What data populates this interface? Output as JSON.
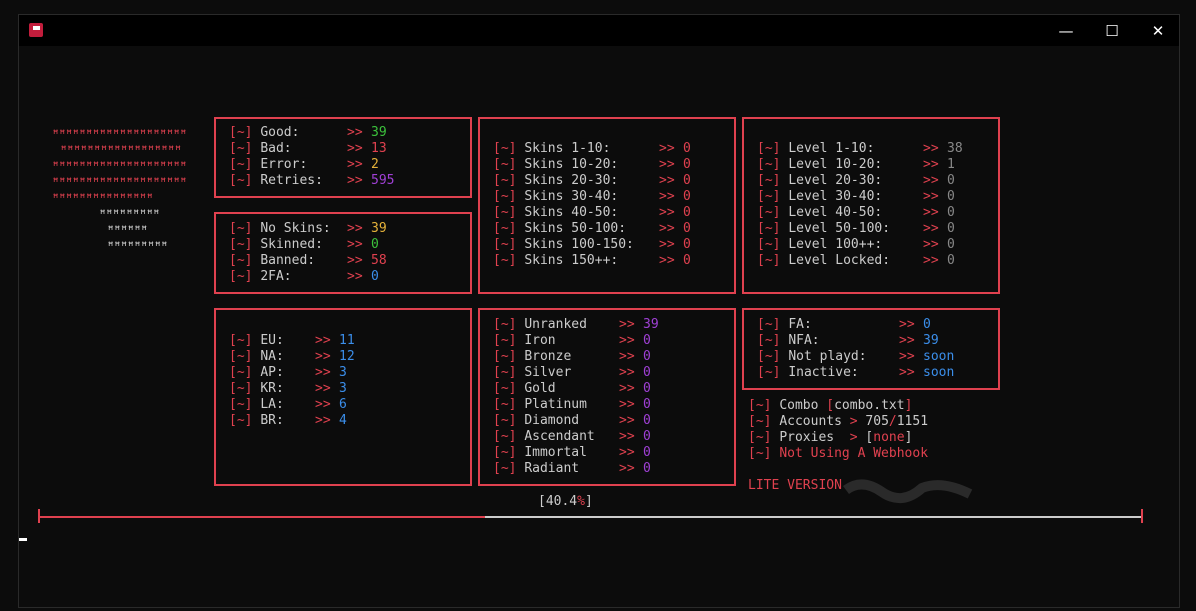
{
  "colors": {
    "accent": "#e0414f",
    "green": "#3cc23c",
    "yellow": "#e5b23a",
    "purple": "#a040d6",
    "blue": "#3b8eea",
    "gray": "#888888",
    "text": "#cccccc"
  },
  "icons": {
    "app": "app-icon",
    "minimize": "minimize-icon",
    "maximize": "maximize-icon",
    "close": "close-icon"
  },
  "titlebar": {
    "min": "—",
    "max": "☐",
    "close": "✕"
  },
  "logo": [
    "ꟸꟸꟸꟸꟸꟸꟸꟸꟸꟸꟸꟸꟸꟸꟸꟸꟸꟸꟸꟸ",
    "ꟸꟸꟸꟸꟸꟸꟸꟸꟸꟸꟸꟸꟸꟸꟸꟸꟸꟸ",
    "ꟸꟸꟸꟸꟸꟸꟸꟸꟸꟸꟸꟸꟸꟸꟸꟸꟸꟸꟸꟸ",
    "ꟸꟸꟸꟸꟸꟸꟸꟸꟸꟸꟸꟸꟸꟸꟸꟸꟸꟸꟸꟸ",
    "ꟸꟸꟸꟸꟸꟸꟸꟸꟸꟸꟸꟸꟸꟸꟸ",
    "ꟸꟸꟸꟸꟸꟸꟸꟸꟸ",
    "ꟸꟸꟸꟸꟸꟸ",
    "ꟸꟸꟸꟸꟸꟸꟸꟸꟸ"
  ],
  "prefix": "[~]",
  "arrow": ">>",
  "results": [
    {
      "label": "Good:",
      "value": "39"
    },
    {
      "label": "Bad:",
      "value": "13"
    },
    {
      "label": "Error:",
      "value": "2"
    },
    {
      "label": "Retries:",
      "value": "595"
    }
  ],
  "account_status": [
    {
      "label": "No Skins:",
      "value": "39"
    },
    {
      "label": "Skinned:",
      "value": "0"
    },
    {
      "label": "Banned:",
      "value": "58"
    },
    {
      "label": "2FA:",
      "value": "0"
    }
  ],
  "regions": [
    {
      "label": "EU:",
      "value": "11"
    },
    {
      "label": "NA:",
      "value": "12"
    },
    {
      "label": "AP:",
      "value": "3"
    },
    {
      "label": "KR:",
      "value": "3"
    },
    {
      "label": "LA:",
      "value": "6"
    },
    {
      "label": "BR:",
      "value": "4"
    }
  ],
  "skins": [
    {
      "label": "Skins 1-10:",
      "value": "0"
    },
    {
      "label": "Skins 10-20:",
      "value": "0"
    },
    {
      "label": "Skins 20-30:",
      "value": "0"
    },
    {
      "label": "Skins 30-40:",
      "value": "0"
    },
    {
      "label": "Skins 40-50:",
      "value": "0"
    },
    {
      "label": "Skins 50-100:",
      "value": "0"
    },
    {
      "label": "Skins 100-150:",
      "value": "0"
    },
    {
      "label": "Skins 150++:",
      "value": "0"
    }
  ],
  "ranks": [
    {
      "label": "Unranked",
      "value": "39"
    },
    {
      "label": "Iron",
      "value": "0"
    },
    {
      "label": "Bronze",
      "value": "0"
    },
    {
      "label": "Silver",
      "value": "0"
    },
    {
      "label": "Gold",
      "value": "0"
    },
    {
      "label": "Platinum",
      "value": "0"
    },
    {
      "label": "Diamond",
      "value": "0"
    },
    {
      "label": "Ascendant",
      "value": "0"
    },
    {
      "label": "Immortal",
      "value": "0"
    },
    {
      "label": "Radiant",
      "value": "0"
    }
  ],
  "levels": [
    {
      "label": "Level 1-10:",
      "value": "38"
    },
    {
      "label": "Level 10-20:",
      "value": "1"
    },
    {
      "label": "Level 20-30:",
      "value": "0"
    },
    {
      "label": "Level 30-40:",
      "value": "0"
    },
    {
      "label": "Level 40-50:",
      "value": "0"
    },
    {
      "label": "Level 50-100:",
      "value": "0"
    },
    {
      "label": "Level 100++:",
      "value": "0"
    },
    {
      "label": "Level Locked:",
      "value": "0"
    }
  ],
  "access": [
    {
      "label": "FA:",
      "value": "0"
    },
    {
      "label": "NFA:",
      "value": "39"
    },
    {
      "label": "Not playd:",
      "value": "soon"
    },
    {
      "label": "Inactive:",
      "value": "soon"
    }
  ],
  "info": {
    "combo_label": "Combo ",
    "combo_open": "[",
    "combo_file": "combo.txt",
    "combo_close": "]",
    "accounts_label": "Accounts ",
    "accounts_arrow": "> ",
    "accounts_done": "705",
    "accounts_sep": "/",
    "accounts_total": "1151",
    "proxies_label": "Proxies ",
    "proxies_arrow": " > ",
    "proxies_open": "[",
    "proxies_value": "none",
    "proxies_close": "]",
    "webhook": "Not Using A Webhook",
    "lite": "LITE VERSION"
  },
  "progress": {
    "open": "[",
    "value": "40.4",
    "pct": "%",
    "close": "]",
    "fraction": 0.404
  }
}
